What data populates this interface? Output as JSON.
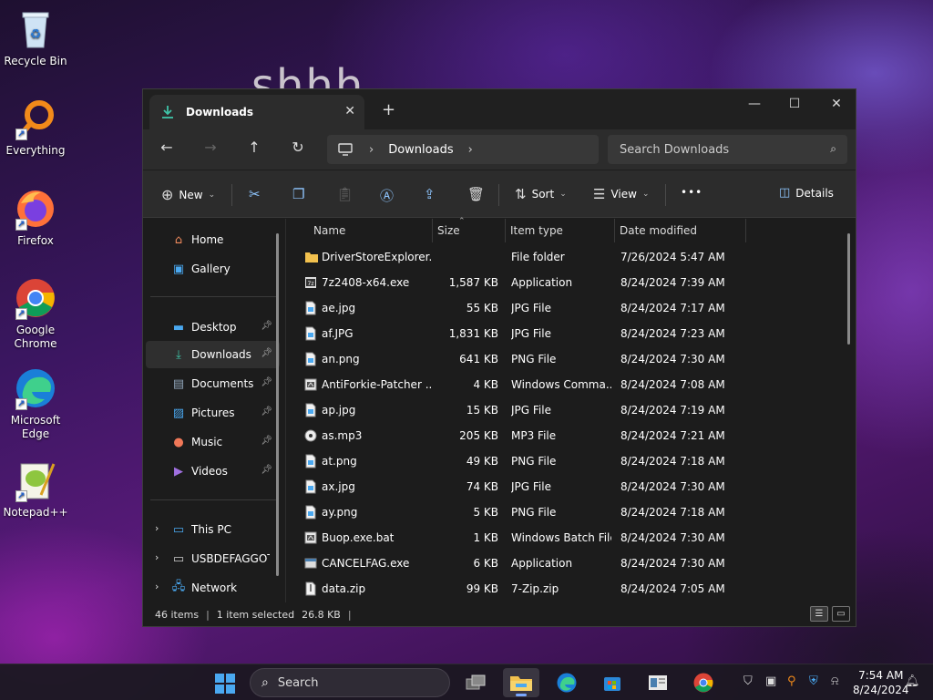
{
  "desktop": {
    "watermark_text": "shhh",
    "icons": [
      {
        "label": "Recycle Bin"
      },
      {
        "label": "Everything"
      },
      {
        "label": "Firefox"
      },
      {
        "label": "Google Chrome"
      },
      {
        "label": "Microsoft Edge"
      },
      {
        "label": "Notepad++"
      }
    ]
  },
  "window": {
    "tab_title": "Downloads",
    "tab_close": "✕",
    "new_tab": "+",
    "controls": {
      "minimize": "—",
      "maximize": "☐",
      "close": "✕"
    },
    "nav": {
      "back": "←",
      "forward": "→",
      "up": "↑",
      "refresh": "↻"
    },
    "breadcrumb": {
      "separator": "›",
      "current": "Downloads"
    },
    "search_placeholder": "Search Downloads",
    "toolbar": {
      "new_label": "New",
      "sort_label": "Sort",
      "view_label": "View",
      "more_label": "•••",
      "details_label": "Details"
    },
    "sidebar": {
      "items": [
        {
          "label": "Home",
          "icon": "home-icon",
          "pinned": false
        },
        {
          "label": "Gallery",
          "icon": "gallery-icon",
          "pinned": false
        },
        {
          "label": "Desktop",
          "icon": "desktop-folder-icon",
          "pinned": true
        },
        {
          "label": "Downloads",
          "icon": "downloads-icon",
          "pinned": true,
          "selected": true
        },
        {
          "label": "Documents",
          "icon": "documents-icon",
          "pinned": true
        },
        {
          "label": "Pictures",
          "icon": "pictures-icon",
          "pinned": true
        },
        {
          "label": "Music",
          "icon": "music-icon",
          "pinned": true
        },
        {
          "label": "Videos",
          "icon": "videos-icon",
          "pinned": true
        },
        {
          "label": "This PC",
          "icon": "this-pc-icon",
          "pinned": false
        },
        {
          "label": "USBDEFAGGOT (",
          "icon": "usb-drive-icon",
          "pinned": false
        },
        {
          "label": "Network",
          "icon": "network-icon",
          "pinned": false
        }
      ]
    },
    "columns": {
      "name": "Name",
      "size": "Size",
      "type": "Item type",
      "date": "Date modified"
    },
    "files": [
      {
        "name": "DriverStoreExplorer....",
        "size": "",
        "type": "File folder",
        "date": "7/26/2024 5:47 AM",
        "icon": "folder"
      },
      {
        "name": "7z2408-x64.exe",
        "size": "1,587 KB",
        "type": "Application",
        "date": "8/24/2024 7:39 AM",
        "icon": "exe"
      },
      {
        "name": "ae.jpg",
        "size": "55 KB",
        "type": "JPG File",
        "date": "8/24/2024 7:17 AM",
        "icon": "image"
      },
      {
        "name": "af.JPG",
        "size": "1,831 KB",
        "type": "JPG File",
        "date": "8/24/2024 7:23 AM",
        "icon": "image"
      },
      {
        "name": "an.png",
        "size": "641 KB",
        "type": "PNG File",
        "date": "8/24/2024 7:30 AM",
        "icon": "image"
      },
      {
        "name": "AntiForkie-Patcher ...",
        "size": "4 KB",
        "type": "Windows Comma...",
        "date": "8/24/2024 7:08 AM",
        "icon": "script"
      },
      {
        "name": "ap.jpg",
        "size": "15 KB",
        "type": "JPG File",
        "date": "8/24/2024 7:19 AM",
        "icon": "image"
      },
      {
        "name": "as.mp3",
        "size": "205 KB",
        "type": "MP3 File",
        "date": "8/24/2024 7:21 AM",
        "icon": "audio"
      },
      {
        "name": "at.png",
        "size": "49 KB",
        "type": "PNG File",
        "date": "8/24/2024 7:18 AM",
        "icon": "image"
      },
      {
        "name": "ax.jpg",
        "size": "74 KB",
        "type": "JPG File",
        "date": "8/24/2024 7:30 AM",
        "icon": "image"
      },
      {
        "name": "ay.png",
        "size": "5 KB",
        "type": "PNG File",
        "date": "8/24/2024 7:18 AM",
        "icon": "image"
      },
      {
        "name": "Buop.exe.bat",
        "size": "1 KB",
        "type": "Windows Batch File",
        "date": "8/24/2024 7:30 AM",
        "icon": "script"
      },
      {
        "name": "CANCELFAG.exe",
        "size": "6 KB",
        "type": "Application",
        "date": "8/24/2024 7:30 AM",
        "icon": "app"
      },
      {
        "name": "data.zip",
        "size": "99 KB",
        "type": "7-Zip.zip",
        "date": "8/24/2024 7:05 AM",
        "icon": "zip"
      }
    ],
    "status": {
      "items": "46 items",
      "selected": "1 item selected",
      "size": "26.8 KB",
      "divider": "|"
    }
  },
  "taskbar": {
    "search_label": "Search",
    "time": "7:54 AM",
    "date": "8/24/2024"
  },
  "colors": {
    "accent": "#4aa8f0",
    "folder": "#f2c14e",
    "window_bg": "#1c1c1c",
    "toolbar_bg": "#2c2c2c"
  }
}
